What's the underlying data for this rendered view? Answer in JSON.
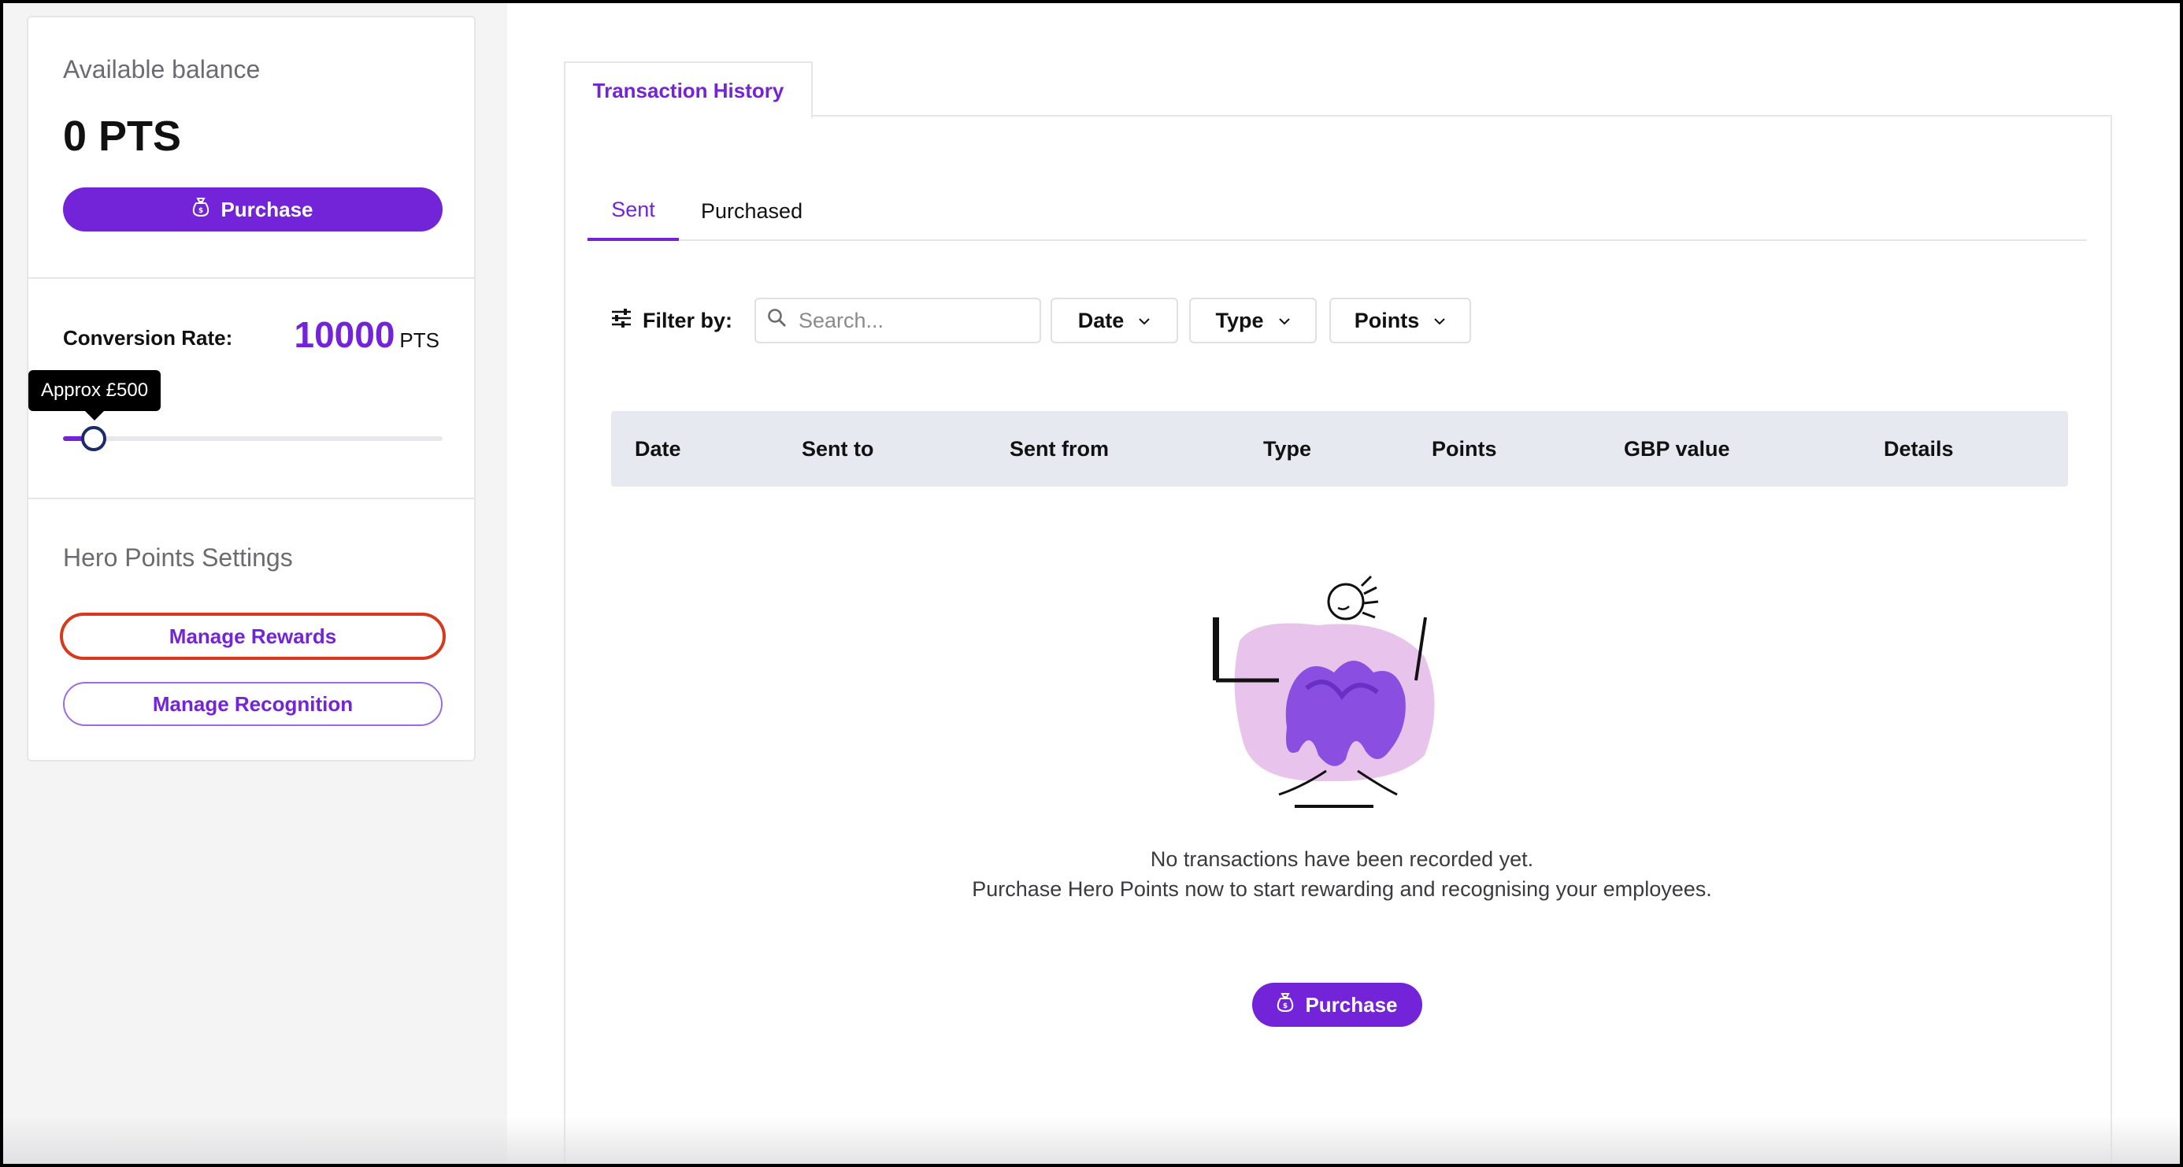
{
  "sidebar": {
    "balance_label": "Available balance",
    "balance_value": "0 PTS",
    "purchase_label": "Purchase",
    "conversion_label": "Conversion Rate:",
    "conversion_value": "10000",
    "conversion_unit": "PTS",
    "slider_tooltip": "Approx £500",
    "slider_level_fraction": 0.08,
    "settings_label": "Hero Points Settings",
    "manage_rewards_label": "Manage Rewards",
    "manage_recognition_label": "Manage Recognition"
  },
  "main": {
    "top_tab_label": "Transaction History",
    "sub_tabs": [
      "Sent",
      "Purchased"
    ],
    "active_sub_tab": "Sent",
    "filter_label": "Filter by:",
    "search_placeholder": "Search...",
    "filters": [
      "Date",
      "Type",
      "Points"
    ],
    "table_headers": [
      "Date",
      "Sent to",
      "Sent from",
      "Type",
      "Points",
      "GBP value",
      "Details"
    ],
    "empty_line_1": "No transactions have been recorded yet.",
    "empty_line_2": "Purchase Hero Points now to start rewarding and recognising your employees.",
    "purchase_label": "Purchase"
  },
  "colors": {
    "accent": "#7424d8",
    "highlight_outline": "#d8391d",
    "table_header_bg": "#e6e9f0"
  },
  "icons": {
    "purchase": "money-bag-icon",
    "filter": "sliders-icon",
    "search": "search-icon",
    "dropdown": "chevron-down-icon"
  }
}
